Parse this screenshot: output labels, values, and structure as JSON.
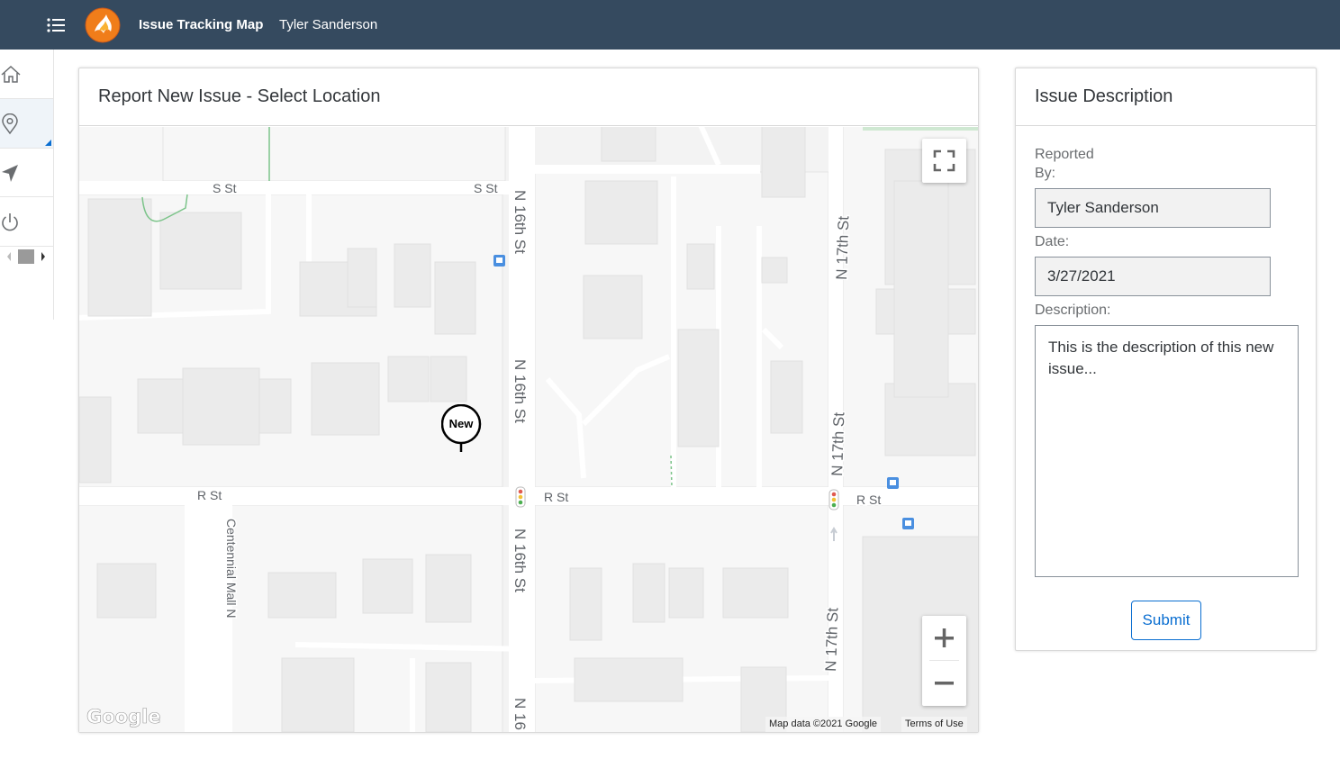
{
  "shell": {
    "app_title": "Issue Tracking Map",
    "user_name": "Tyler Sanderson",
    "header_color": "#354a5f"
  },
  "sidebar": {
    "items": [
      {
        "icon": "home-icon"
      },
      {
        "icon": "location-pin-icon",
        "active": true
      },
      {
        "icon": "navigation-arrow-icon"
      },
      {
        "icon": "power-icon"
      }
    ]
  },
  "map_panel": {
    "title": "Report New Issue - Select Location",
    "streets": {
      "s_st_left": "S St",
      "s_st_right": "S St",
      "r_st_left": "R St",
      "r_st_mid": "R St",
      "r_st_right": "R St",
      "n16_top": "N 16th St",
      "n16_mid": "N 16th St",
      "n16_low": "N 16th St",
      "n16_bottom": "N 16",
      "n17_top": "N 17th St",
      "n17_mid": "N 17th St",
      "n17_bottom": "N 17th St",
      "centennial": "Centennial Mall N"
    },
    "marker_label": "New",
    "attribution": "Map data ©2021 Google",
    "terms": "Terms of Use",
    "google_logo": "Google"
  },
  "desc_panel": {
    "title": "Issue Description",
    "reported_by_label": "Reported By:",
    "reported_by_value": "Tyler Sanderson",
    "date_label": "Date:",
    "date_value": "3/27/2021",
    "description_label": "Description:",
    "description_value": "This is the description of this new issue...",
    "submit_label": "Submit",
    "accent_color": "#0a6ed1"
  }
}
